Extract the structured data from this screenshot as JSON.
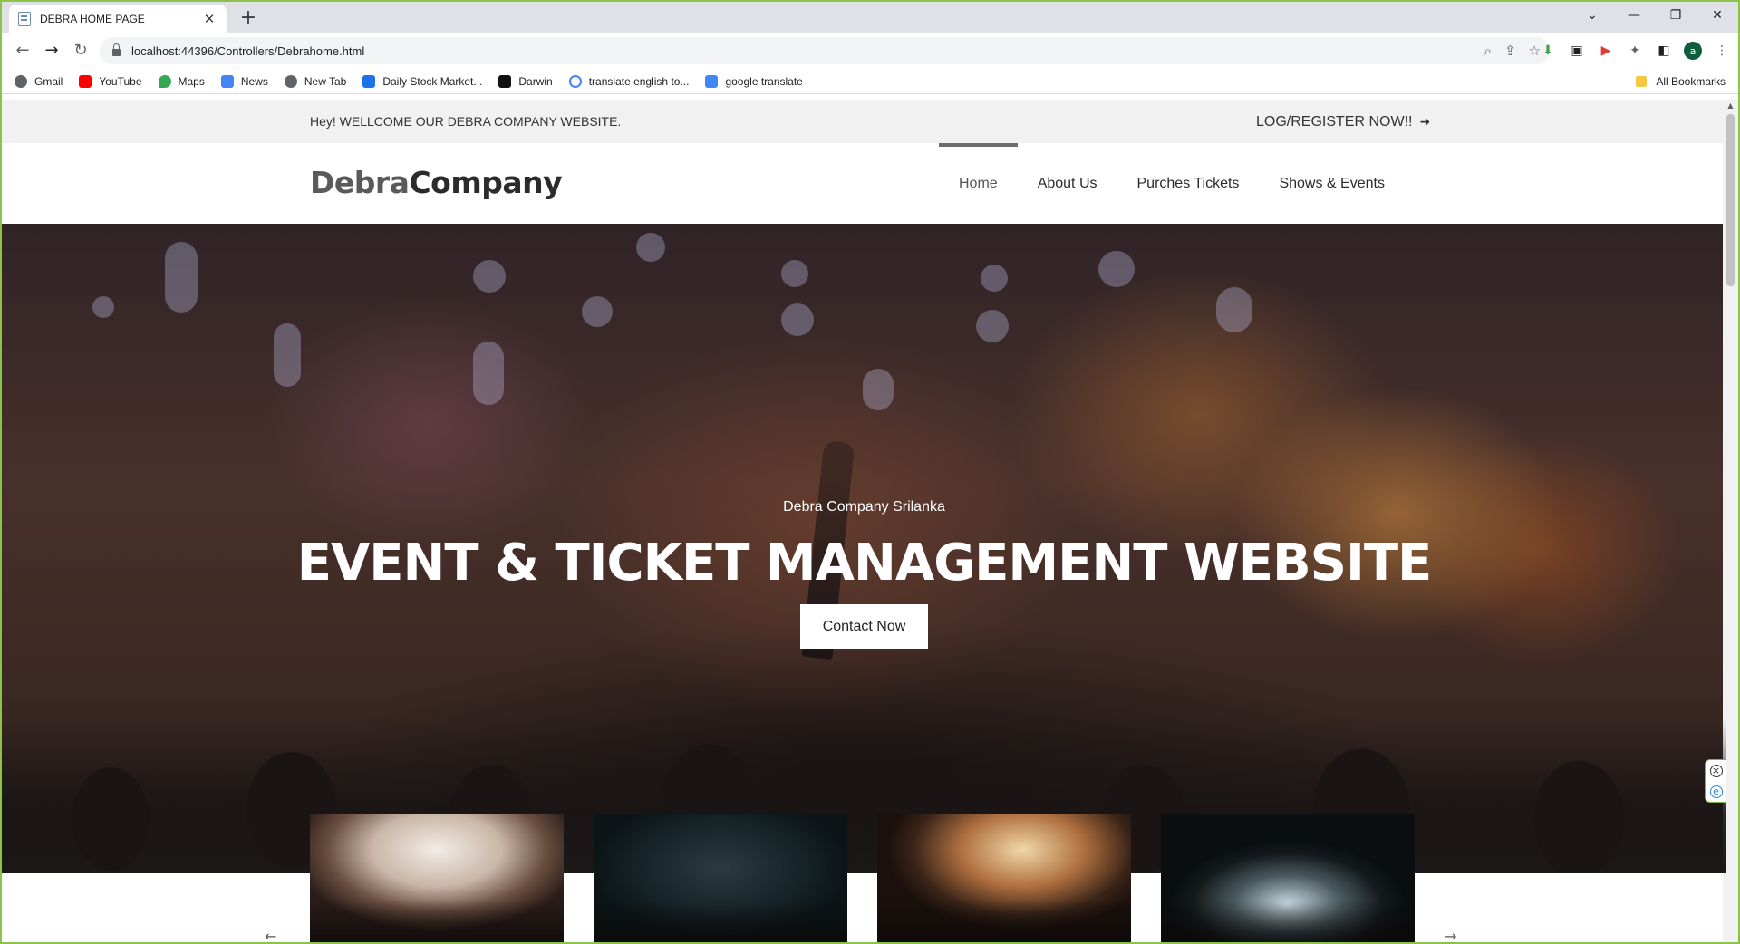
{
  "browser": {
    "tab_title": "DEBRA HOME PAGE",
    "tab_close": "✕",
    "new_tab": "+",
    "url": "localhost:44396/Controllers/Debrahome.html",
    "window_controls": [
      "⌄",
      "—",
      "❐",
      "✕"
    ],
    "avatar_letter": "a",
    "bookmarks": [
      {
        "label": "Gmail",
        "icon": "gmail-icon",
        "color": "#5f6368"
      },
      {
        "label": "YouTube",
        "icon": "youtube-icon",
        "color": "#ff0000"
      },
      {
        "label": "Maps",
        "icon": "maps-icon",
        "color": "#34a853"
      },
      {
        "label": "News",
        "icon": "news-icon",
        "color": "#4285f4"
      },
      {
        "label": "New Tab",
        "icon": "globe-icon",
        "color": "#5f6368"
      },
      {
        "label": "Daily Stock Market...",
        "icon": "stock-icon",
        "color": "#1a73e8"
      },
      {
        "label": "Darwin",
        "icon": "darwin-icon",
        "color": "#111111"
      },
      {
        "label": "translate english to...",
        "icon": "google-icon",
        "color": "#4285f4"
      },
      {
        "label": "google translate",
        "icon": "translate-icon",
        "color": "#4285f4"
      }
    ],
    "all_bookmarks": "All Bookmarks"
  },
  "page": {
    "topbar": {
      "welcome": "Hey! WELLCOME OUR DEBRA COMPANY WEBSITE.",
      "login": "LOG/REGISTER NOW!!",
      "login_arrow": "➜"
    },
    "logo": {
      "part1": "Debra",
      "part2": "Company"
    },
    "menu": [
      "Home",
      "About Us",
      "Purches Tickets",
      "Shows & Events"
    ],
    "active_menu": "Home",
    "hero": {
      "subtitle": "Debra Company Srilanka",
      "title": "EVENT & TICKET MANAGEMENT WEBSITE",
      "button": "Contact Now"
    },
    "carousel": {
      "prev": "←",
      "next": "→"
    }
  }
}
